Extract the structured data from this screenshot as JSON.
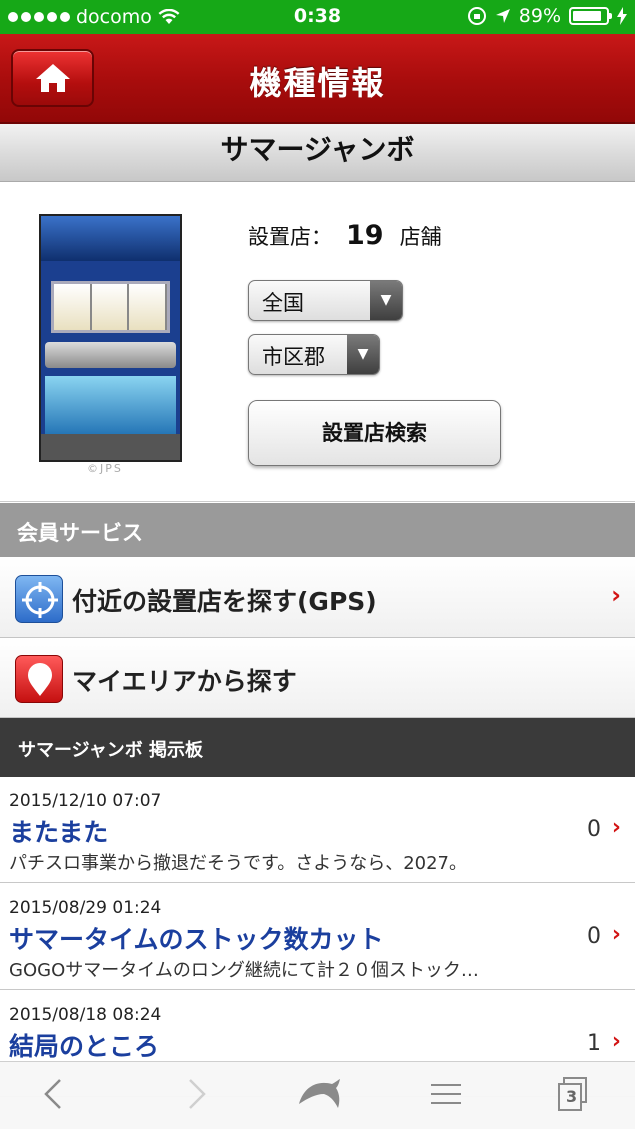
{
  "status_bar": {
    "carrier": "docomo",
    "time": "0:38",
    "battery": "89%",
    "battery_level": 0.89
  },
  "header": {
    "title": "機種情報",
    "home_icon": "home-icon"
  },
  "machine": {
    "name": "サマージャンボ",
    "copyright": "©JPS",
    "shop_count_label": "設置店：",
    "shop_count": "19",
    "shop_count_unit": "店舗",
    "region_select": "全国",
    "city_select": "市区郡",
    "search_button": "設置店検索"
  },
  "member_service": {
    "heading": "会員サービス",
    "items": [
      {
        "label": "付近の設置店を探す(GPS)",
        "icon": "gps-target-icon"
      },
      {
        "label": "マイエリアから探す",
        "icon": "map-pin-icon"
      }
    ]
  },
  "board": {
    "heading": "サマージャンボ 掲示板",
    "posts": [
      {
        "date": "2015/12/10 07:07",
        "title": "またまた",
        "excerpt": "パチスロ事業から撤退だそうです。さようなら、2027。",
        "count": "0"
      },
      {
        "date": "2015/08/29 01:24",
        "title": "サマータイムのストック数カット",
        "excerpt": "GOGOサマータイムのロング継続にて計２０個ストック…",
        "count": "0"
      },
      {
        "date": "2015/08/18 08:24",
        "title": "結局のところ",
        "excerpt": "",
        "count": "1"
      }
    ]
  },
  "toolbar": {
    "tabs_count": "3"
  }
}
